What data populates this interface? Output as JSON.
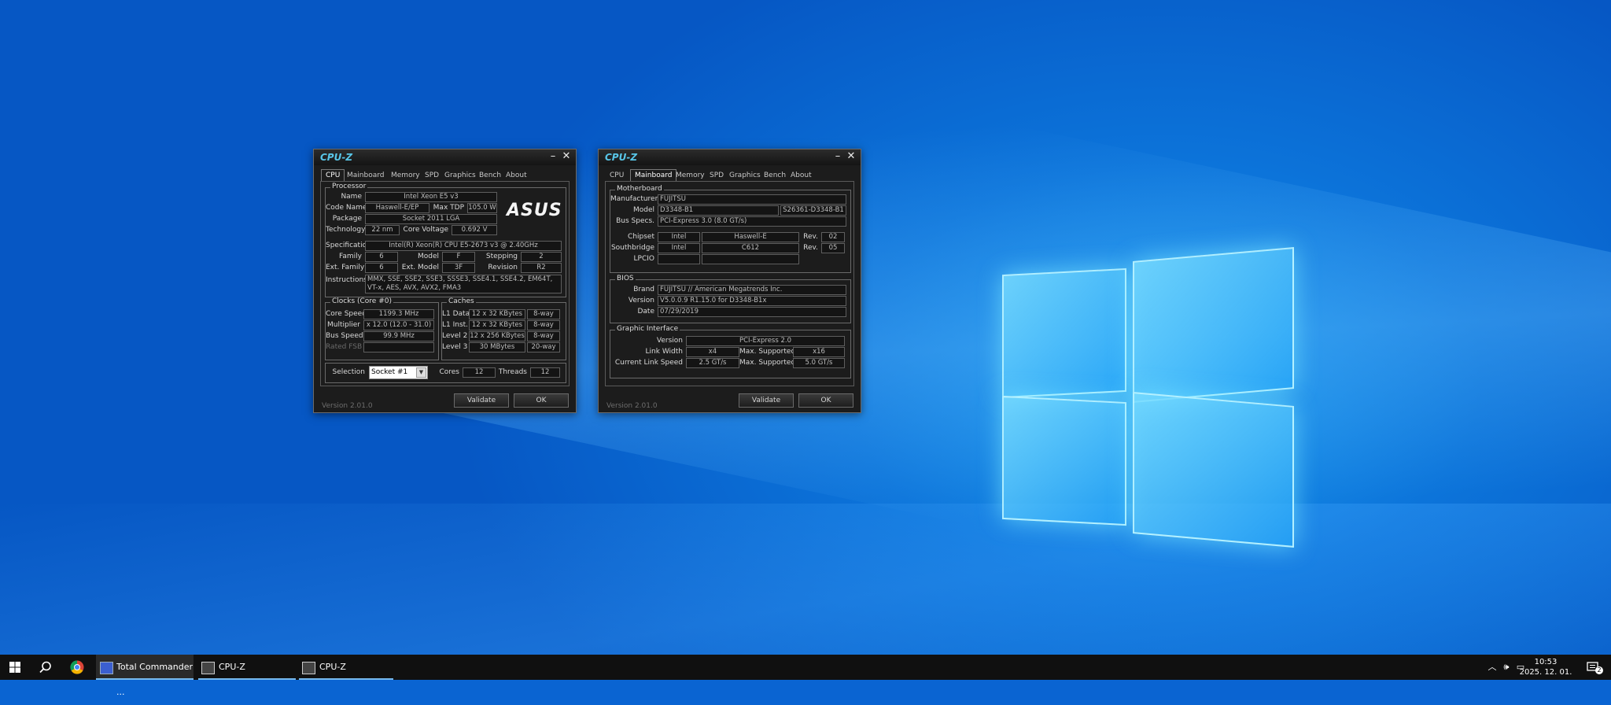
{
  "window1": {
    "title": "CPU-Z",
    "tabs": [
      "CPU",
      "Mainboard",
      "Memory",
      "SPD",
      "Graphics",
      "Bench",
      "About"
    ],
    "active_tab": "CPU",
    "processor": {
      "group": "Processor",
      "name_label": "Name",
      "name": "Intel Xeon E5 v3",
      "codename_label": "Code Name",
      "codename": "Haswell-E/EP",
      "maxtdp_label": "Max TDP",
      "maxtdp": "105.0 W",
      "package_label": "Package",
      "package": "Socket 2011 LGA",
      "technology_label": "Technology",
      "technology": "22 nm",
      "corevoltage_label": "Core Voltage",
      "corevoltage": "0.692 V",
      "spec_label": "Specification",
      "spec": "Intel(R) Xeon(R) CPU E5-2673 v3 @ 2.40GHz",
      "family_label": "Family",
      "family": "6",
      "model_label": "Model",
      "model": "F",
      "stepping_label": "Stepping",
      "stepping": "2",
      "extfamily_label": "Ext. Family",
      "extfamily": "6",
      "extmodel_label": "Ext. Model",
      "extmodel": "3F",
      "revision_label": "Revision",
      "revision": "R2",
      "instructions_label": "Instructions",
      "instructions": "MMX, SSE, SSE2, SSE3, SSSE3, SSE4.1, SSE4.2, EM64T, VT-x, AES, AVX, AVX2, FMA3",
      "logo": "ASUS"
    },
    "clocks": {
      "group": "Clocks (Core #0)",
      "corespeed_label": "Core Speed",
      "corespeed": "1199.3 MHz",
      "multiplier_label": "Multiplier",
      "multiplier": "x 12.0 (12.0 - 31.0)",
      "busspeed_label": "Bus Speed",
      "busspeed": "99.9 MHz",
      "ratedfsb_label": "Rated FSB",
      "ratedfsb": ""
    },
    "caches": {
      "group": "Caches",
      "l1d_label": "L1 Data",
      "l1d": "12 x 32 KBytes",
      "l1d_way": "8-way",
      "l1i_label": "L1 Inst.",
      "l1i": "12 x 32 KBytes",
      "l1i_way": "8-way",
      "l2_label": "Level 2",
      "l2": "12 x 256 KBytes",
      "l2_way": "8-way",
      "l3_label": "Level 3",
      "l3": "30 MBytes",
      "l3_way": "20-way"
    },
    "selection_label": "Selection",
    "selection": "Socket #1",
    "cores_label": "Cores",
    "cores": "12",
    "threads_label": "Threads",
    "threads": "12",
    "version": "Version 2.01.0",
    "validate": "Validate",
    "ok": "OK"
  },
  "window2": {
    "title": "CPU-Z",
    "tabs": [
      "CPU",
      "Mainboard",
      "Memory",
      "SPD",
      "Graphics",
      "Bench",
      "About"
    ],
    "active_tab": "Mainboard",
    "motherboard": {
      "group": "Motherboard",
      "manufacturer_label": "Manufacturer",
      "manufacturer": "FUJITSU",
      "model_label": "Model",
      "model": "D3348-B1",
      "model2": "S26361-D3348-B1",
      "busspecs_label": "Bus Specs.",
      "busspecs": "PCI-Express 3.0 (8.0 GT/s)",
      "chipset_label": "Chipset",
      "chipset_vendor": "Intel",
      "chipset": "Haswell-E",
      "chipset_rev_label": "Rev.",
      "chipset_rev": "02",
      "southbridge_label": "Southbridge",
      "southbridge_vendor": "Intel",
      "southbridge": "C612",
      "southbridge_rev_label": "Rev.",
      "southbridge_rev": "05",
      "lpcio_label": "LPCIO",
      "lpcio_vendor": "",
      "lpcio": ""
    },
    "bios": {
      "group": "BIOS",
      "brand_label": "Brand",
      "brand": "FUJITSU // American Megatrends Inc.",
      "version_label": "Version",
      "version": "V5.0.0.9 R1.15.0 for D3348-B1x",
      "date_label": "Date",
      "date": "07/29/2019"
    },
    "graphic": {
      "group": "Graphic Interface",
      "version_label": "Version",
      "version": "PCI-Express 2.0",
      "linkwidth_label": "Link Width",
      "linkwidth": "x4",
      "maxsupported_label": "Max. Supported",
      "maxwidth": "x16",
      "linkspeed_label": "Current Link Speed",
      "linkspeed": "2.5 GT/s",
      "maxspeed": "5.0 GT/s"
    },
    "version": "Version 2.01.0",
    "validate": "Validate",
    "ok": "OK"
  },
  "taskbar": {
    "apps": [
      {
        "label": "Total Commander ..."
      },
      {
        "label": "CPU-Z"
      },
      {
        "label": "CPU-Z"
      }
    ],
    "clock_time": "10:53",
    "clock_date": "2025. 12. 01.",
    "notification_count": "2"
  },
  "colors": {
    "desktop": "#0a64d2",
    "cpuz_bg": "#1c1c1c",
    "cpuz_title": "#58c6e8",
    "taskbar": "#101010",
    "taskbar_accent": "#76b9ed"
  }
}
